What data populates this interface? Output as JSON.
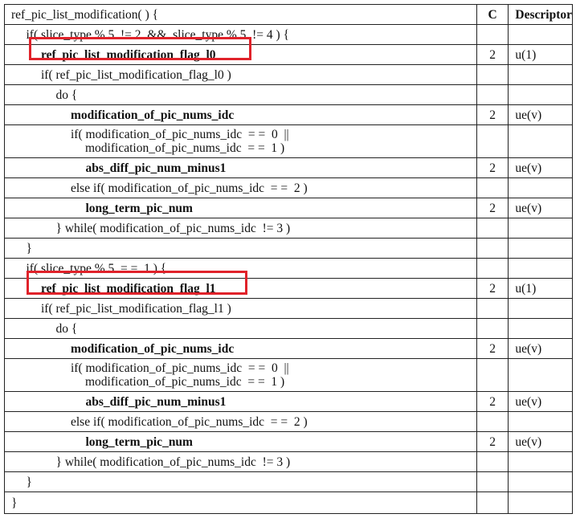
{
  "header": {
    "syntax": "ref_pic_list_modification( ) {",
    "c": "C",
    "descriptor": "Descriptor"
  },
  "rows": [
    {
      "indent": 1,
      "text": "if( slice_type % 5  != 2  &&  slice_type % 5  != 4 ) {",
      "c": "",
      "d": ""
    },
    {
      "indent": 2,
      "text": "ref_pic_list_modification_flag_l0",
      "bold": true,
      "highlight": 0,
      "c": "2",
      "d": "u(1)"
    },
    {
      "indent": 2,
      "text": "if( ref_pic_list_modification_flag_l0 )",
      "c": "",
      "d": ""
    },
    {
      "indent": 3,
      "text": "do {",
      "c": "",
      "d": ""
    },
    {
      "indent": 4,
      "text": "modification_of_pic_nums_idc",
      "bold": true,
      "c": "2",
      "d": "ue(v)"
    },
    {
      "indent": 4,
      "text": "if( modification_of_pic_nums_idc  = =  0  ||",
      "text2": "modification_of_pic_nums_idc  = =  1 )",
      "c": "",
      "d": ""
    },
    {
      "indent": 5,
      "text": "abs_diff_pic_num_minus1",
      "bold": true,
      "c": "2",
      "d": "ue(v)"
    },
    {
      "indent": 4,
      "text": "else if( modification_of_pic_nums_idc  = =  2 )",
      "c": "",
      "d": ""
    },
    {
      "indent": 5,
      "text": "long_term_pic_num",
      "bold": true,
      "c": "2",
      "d": "ue(v)"
    },
    {
      "indent": 3,
      "text": "} while( modification_of_pic_nums_idc  != 3 )",
      "c": "",
      "d": ""
    },
    {
      "indent": 1,
      "text": "}",
      "c": "",
      "d": ""
    },
    {
      "indent": 1,
      "text": "if( slice_type % 5  = =  1 ) {",
      "c": "",
      "d": ""
    },
    {
      "indent": 2,
      "text": "ref_pic_list_modification_flag_l1",
      "bold": true,
      "highlight": 1,
      "c": "2",
      "d": "u(1)"
    },
    {
      "indent": 2,
      "text": "if( ref_pic_list_modification_flag_l1 )",
      "c": "",
      "d": ""
    },
    {
      "indent": 3,
      "text": "do {",
      "c": "",
      "d": ""
    },
    {
      "indent": 4,
      "text": "modification_of_pic_nums_idc",
      "bold": true,
      "c": "2",
      "d": "ue(v)"
    },
    {
      "indent": 4,
      "text": "if( modification_of_pic_nums_idc  = =  0  ||",
      "text2": "modification_of_pic_nums_idc  = =  1 )",
      "c": "",
      "d": ""
    },
    {
      "indent": 5,
      "text": "abs_diff_pic_num_minus1",
      "bold": true,
      "c": "2",
      "d": "ue(v)"
    },
    {
      "indent": 4,
      "text": "else if( modification_of_pic_nums_idc  = =  2 )",
      "c": "",
      "d": ""
    },
    {
      "indent": 5,
      "text": "long_term_pic_num",
      "bold": true,
      "c": "2",
      "d": "ue(v)"
    },
    {
      "indent": 3,
      "text": "} while( modification_of_pic_nums_idc  != 3 )",
      "c": "",
      "d": ""
    },
    {
      "indent": 1,
      "text": "}",
      "c": "",
      "d": ""
    },
    {
      "indent": 0,
      "text": "}",
      "c": "",
      "d": ""
    }
  ],
  "colors": {
    "highlight": "#e0222a",
    "border": "#222222"
  }
}
